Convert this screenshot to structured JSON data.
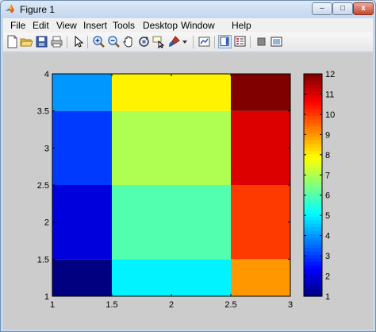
{
  "window": {
    "title": "Figure 1"
  },
  "window_buttons": {
    "minimize": "–",
    "maximize": "□",
    "close": "x"
  },
  "menu": [
    "File",
    "Edit",
    "View",
    "Insert",
    "Tools",
    "Desktop",
    "Window",
    "Help"
  ],
  "toolbar_icons": [
    "new-figure-icon",
    "open-file-icon",
    "save-icon",
    "print-icon",
    "edit-plot-arrow-icon",
    "zoom-in-icon",
    "zoom-out-icon",
    "pan-hand-icon",
    "rotate-3d-icon",
    "data-cursor-icon",
    "brush-icon",
    "brush-dropdown-icon",
    "link-plot-icon",
    "insert-colorbar-icon",
    "insert-legend-icon",
    "hide-plot-tools-icon",
    "show-plot-tools-icon"
  ],
  "colors": {
    "titlebar": "#c4d7ed",
    "figure_bg": "#cccccc",
    "axes_bg": "#ffffff"
  },
  "chart_data": {
    "type": "heatmap",
    "colormap": "jet",
    "x_edges": [
      1,
      1.5,
      2.5,
      3
    ],
    "y_edges": [
      1,
      1.5,
      2.5,
      3.5,
      4
    ],
    "values": [
      [
        1,
        5,
        9
      ],
      [
        2,
        6,
        10
      ],
      [
        3,
        7,
        11
      ],
      [
        4,
        8,
        12
      ]
    ],
    "xlim": [
      1,
      3
    ],
    "ylim": [
      1,
      4
    ],
    "x_ticks": [
      1,
      1.5,
      2,
      2.5,
      3
    ],
    "x_tick_labels": [
      "1",
      "1.5",
      "2",
      "2.5",
      "3"
    ],
    "y_ticks": [
      1,
      1.5,
      2,
      2.5,
      3,
      3.5,
      4
    ],
    "y_tick_labels": [
      "1",
      "1.5",
      "2",
      "2.5",
      "3",
      "3.5",
      "4"
    ],
    "colorbar": {
      "range": [
        1,
        12
      ],
      "ticks": [
        1,
        2,
        3,
        4,
        5,
        6,
        7,
        8,
        9,
        10,
        11,
        12
      ],
      "tick_labels": [
        "1",
        "2",
        "3",
        "4",
        "5",
        "6",
        "7",
        "8",
        "9",
        "10",
        "11",
        "12"
      ]
    },
    "title": "",
    "xlabel": "",
    "ylabel": "",
    "grid": false
  }
}
